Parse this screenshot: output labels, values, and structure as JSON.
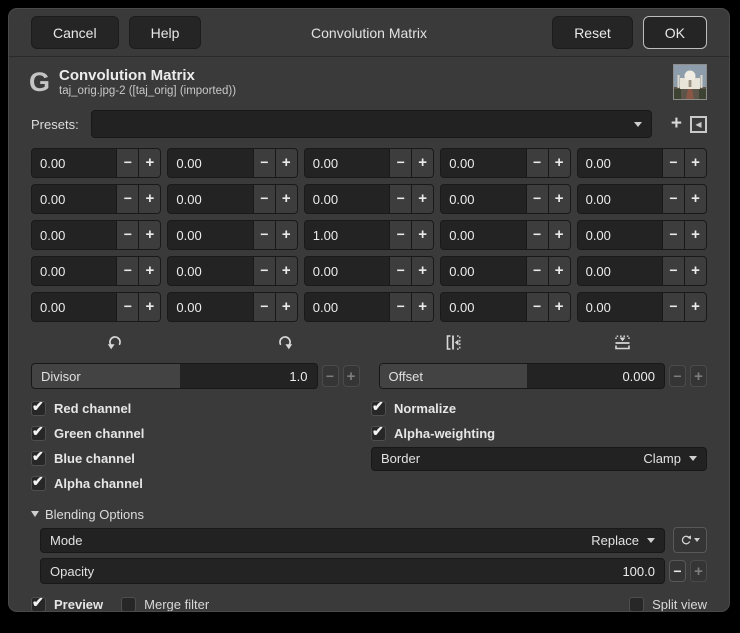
{
  "titlebar": {
    "cancel_label": "Cancel",
    "help_label": "Help",
    "title": "Convolution Matrix",
    "reset_label": "Reset",
    "ok_label": "OK"
  },
  "header": {
    "logo": "G",
    "title": "Convolution Matrix",
    "subtitle": "taj_orig.jpg-2 ([taj_orig] (imported))"
  },
  "presets": {
    "label": "Presets:",
    "value": ""
  },
  "matrix": {
    "values": [
      [
        "0.00",
        "0.00",
        "0.00",
        "0.00",
        "0.00"
      ],
      [
        "0.00",
        "0.00",
        "0.00",
        "0.00",
        "0.00"
      ],
      [
        "0.00",
        "0.00",
        "1.00",
        "0.00",
        "0.00"
      ],
      [
        "0.00",
        "0.00",
        "0.00",
        "0.00",
        "0.00"
      ],
      [
        "0.00",
        "0.00",
        "0.00",
        "0.00",
        "0.00"
      ]
    ]
  },
  "divisor": {
    "label": "Divisor",
    "value": "1.0",
    "fill_percent": 52
  },
  "offset": {
    "label": "Offset",
    "value": "0.000",
    "fill_percent": 52
  },
  "channels": [
    {
      "label": "Red channel",
      "checked": true
    },
    {
      "label": "Green channel",
      "checked": true
    },
    {
      "label": "Blue channel",
      "checked": true
    },
    {
      "label": "Alpha channel",
      "checked": true
    }
  ],
  "options": [
    {
      "label": "Normalize",
      "checked": true
    },
    {
      "label": "Alpha-weighting",
      "checked": true
    }
  ],
  "border": {
    "label": "Border",
    "value": "Clamp"
  },
  "blending": {
    "title": "Blending Options",
    "mode_label": "Mode",
    "mode_value": "Replace",
    "opacity_label": "Opacity",
    "opacity_value": "100.0",
    "opacity_fill_percent": 0
  },
  "footer": {
    "preview": {
      "label": "Preview",
      "checked": true
    },
    "merge": {
      "label": "Merge filter",
      "checked": false
    },
    "split": {
      "label": "Split view",
      "checked": false
    }
  },
  "colors": {
    "window_bg": "#3a3a3a",
    "field_bg": "#232323",
    "focus_border": "#bdbdbd",
    "text": "#e6e6e6"
  }
}
